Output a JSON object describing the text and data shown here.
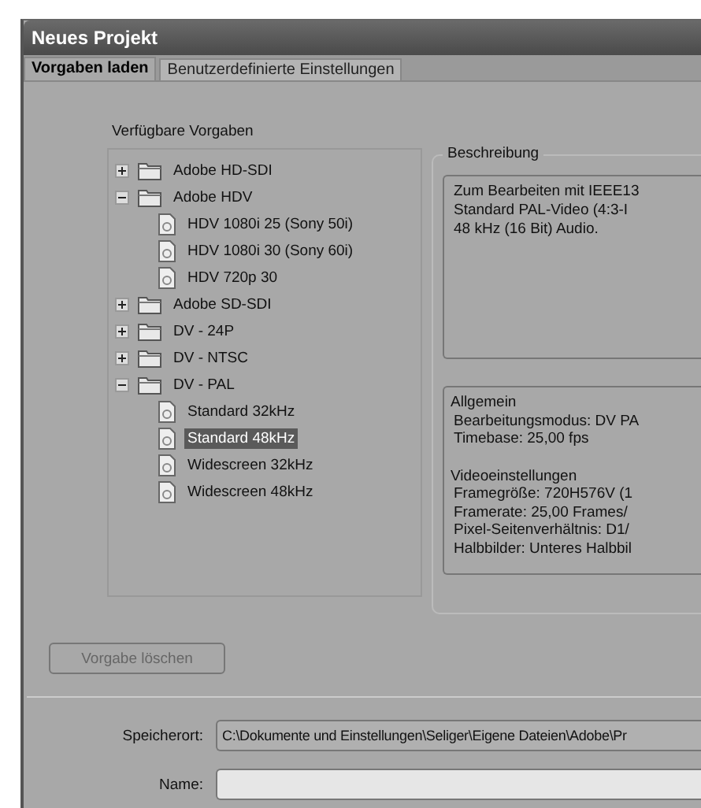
{
  "window": {
    "title": "Neues Projekt"
  },
  "tabs": [
    {
      "label": "Vorgaben laden",
      "selected": true
    },
    {
      "label": "Benutzerdefinierte Einstellungen",
      "selected": false
    }
  ],
  "presets": {
    "label": "Verfügbare Vorgaben",
    "tree": [
      {
        "label": "Adobe HD-SDI",
        "kind": "folder",
        "expanded": false,
        "selected": false
      },
      {
        "label": "Adobe HDV",
        "kind": "folder",
        "expanded": true,
        "selected": false,
        "children": [
          {
            "label": "HDV 1080i 25 (Sony 50i)",
            "kind": "preset",
            "selected": false
          },
          {
            "label": "HDV 1080i 30 (Sony 60i)",
            "kind": "preset",
            "selected": false
          },
          {
            "label": "HDV 720p 30",
            "kind": "preset",
            "selected": false
          }
        ]
      },
      {
        "label": "Adobe SD-SDI",
        "kind": "folder",
        "expanded": false,
        "selected": false
      },
      {
        "label": "DV - 24P",
        "kind": "folder",
        "expanded": false,
        "selected": false
      },
      {
        "label": "DV - NTSC",
        "kind": "folder",
        "expanded": false,
        "selected": false
      },
      {
        "label": "DV - PAL",
        "kind": "folder",
        "expanded": true,
        "selected": false,
        "children": [
          {
            "label": "Standard 32kHz",
            "kind": "preset",
            "selected": false
          },
          {
            "label": "Standard 48kHz",
            "kind": "preset",
            "selected": true
          },
          {
            "label": "Widescreen 32kHz",
            "kind": "preset",
            "selected": false
          },
          {
            "label": "Widescreen 48kHz",
            "kind": "preset",
            "selected": false
          }
        ]
      }
    ]
  },
  "description": {
    "legend": "Beschreibung",
    "text_lines": [
      "Zum Bearbeiten mit IEEE13",
      "Standard PAL-Video (4:3-I",
      "48 kHz (16 Bit) Audio."
    ],
    "details": [
      {
        "heading": "Allgemein",
        "lines": [
          "Bearbeitungsmodus: DV PA",
          "Timebase: 25,00 fps"
        ]
      },
      {
        "heading": "Videoeinstellungen",
        "lines": [
          "Framegröße: 720H576V (1",
          "Framerate: 25,00 Frames/",
          "Pixel-Seitenverhältnis: D1/",
          "Halbbilder: Unteres Halbbil"
        ]
      }
    ]
  },
  "delete_button": {
    "label": "Vorgabe löschen",
    "disabled": true
  },
  "location": {
    "label": "Speicherort:",
    "value": "C:\\Dokumente und Einstellungen\\Seliger\\Eigene Dateien\\Adobe\\Pr"
  },
  "name": {
    "label": "Name:"
  }
}
